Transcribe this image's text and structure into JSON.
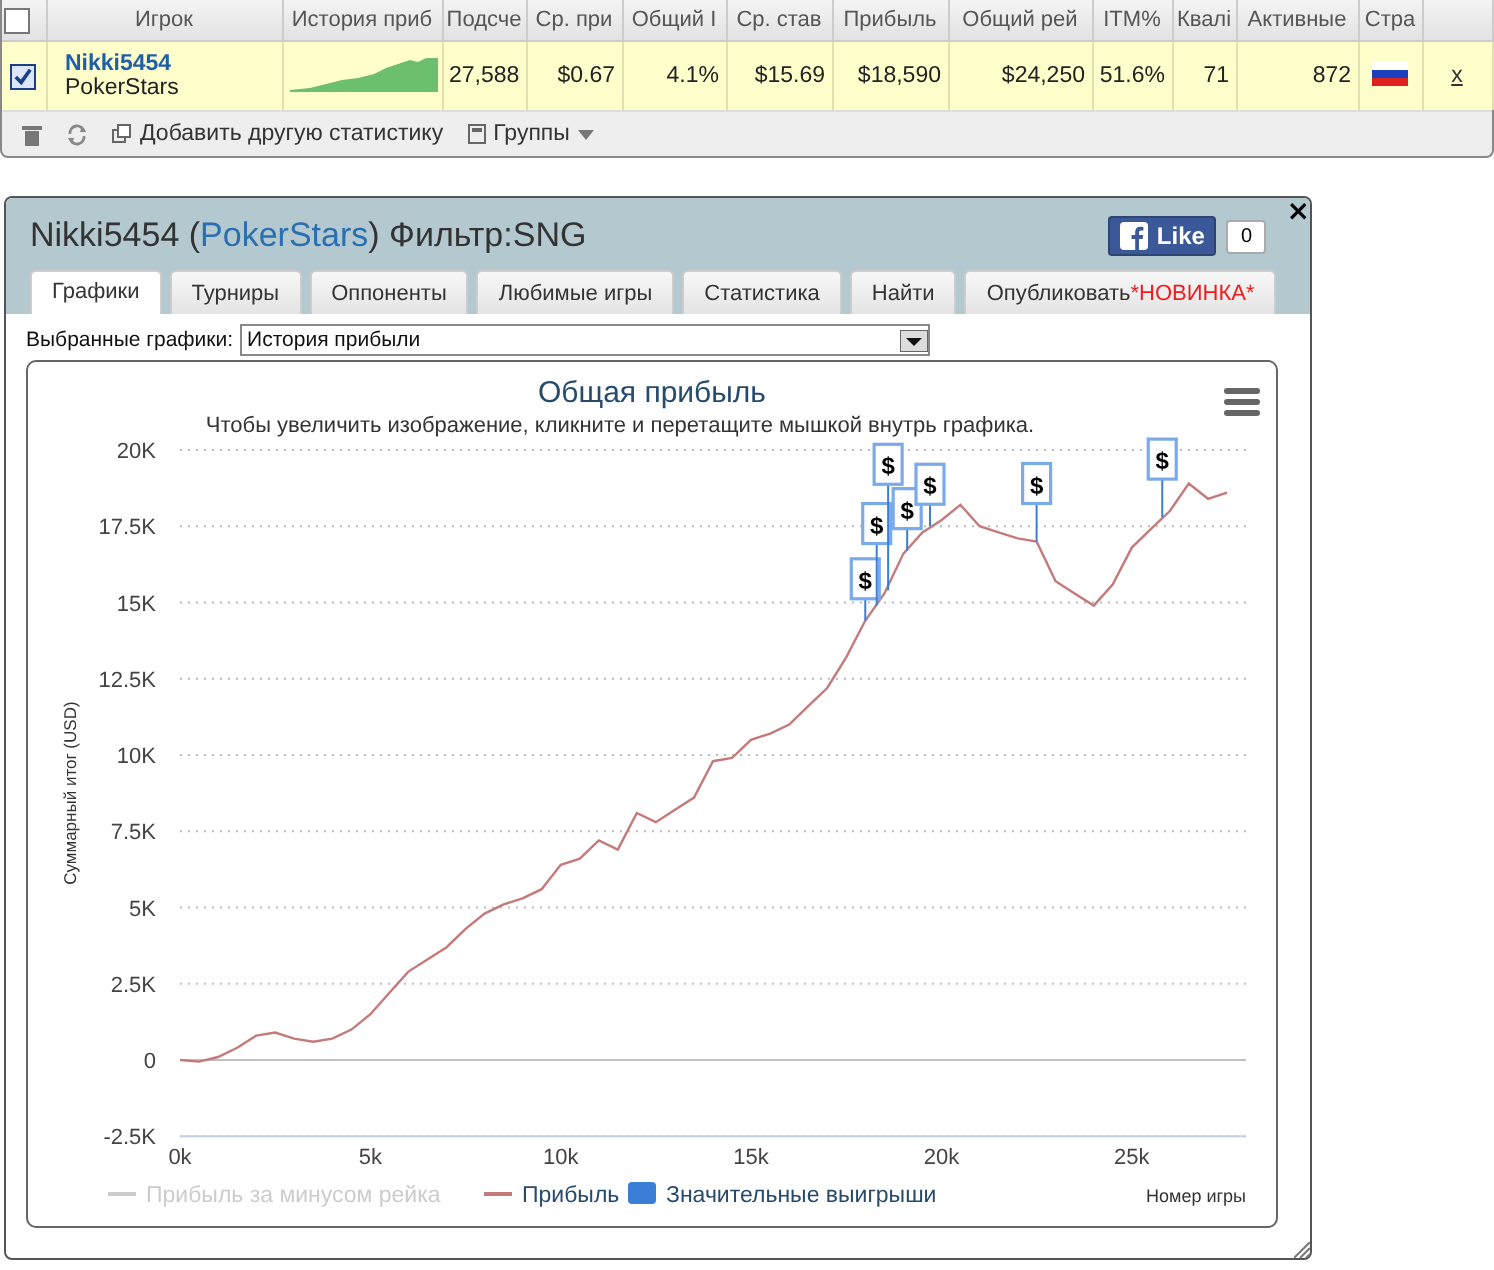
{
  "stats_table": {
    "header_checked": false,
    "columns": [
      "",
      "Игрок",
      "История приб",
      "Подсче",
      "Ср. при",
      "Общий I",
      "Ср. став",
      "Прибыль",
      "Общий рей",
      "ITM%",
      "Квалі",
      "Активные",
      "Стра",
      ""
    ],
    "rows": [
      {
        "cells": [
          {
            "kind": "checkbox",
            "checked": true
          },
          {
            "kind": "player",
            "player": "Nikki5454",
            "site": "PokerStars"
          },
          {
            "kind": "sparkline"
          },
          {
            "kind": "text",
            "text": "27,588"
          },
          {
            "kind": "text",
            "text": "$0.67"
          },
          {
            "kind": "text",
            "text": "4.1%"
          },
          {
            "kind": "text",
            "text": "$15.69"
          },
          {
            "kind": "text",
            "text": "$18,590"
          },
          {
            "kind": "text",
            "text": "$24,250"
          },
          {
            "kind": "text",
            "text": "51.6%"
          },
          {
            "kind": "text",
            "text": "71"
          },
          {
            "kind": "text",
            "text": "872"
          },
          {
            "kind": "flag"
          },
          {
            "kind": "link",
            "text": "x"
          }
        ]
      }
    ],
    "toolbar": {
      "add_stat": "Добавить другую статистику",
      "groups": "Группы"
    }
  },
  "dialog": {
    "title_player": "Nikki5454 (",
    "title_site": "PokerStars",
    "title_filter": ") Фильтр:SNG",
    "like": "Like",
    "like_count": "0",
    "close": "×",
    "tabs": [
      {
        "label": "Графики",
        "selected": true
      },
      {
        "label": "Турниры",
        "selected": false
      },
      {
        "label": "Оппоненты",
        "selected": false
      },
      {
        "label": "Любимые игры",
        "selected": false
      },
      {
        "label": "Статистика",
        "selected": false
      },
      {
        "label": "Найти",
        "selected": false
      },
      {
        "label": "Опубликовать",
        "badge": "*НОВИНКА*",
        "selected": false
      }
    ],
    "graph_select": {
      "label": "Выбранные графики:",
      "value": "История прибыли"
    },
    "chart": {
      "hint": "Чтобы увеличить изображение, кликните и перетащите мышкой внутрь графика.",
      "legend": [
        {
          "label": "Прибыль за минусом рейка",
          "kind": "line",
          "hidden": true
        },
        {
          "kind": "series",
          "hidden": false
        },
        {
          "label": "Значительные выигрыши",
          "kind": "box",
          "hidden": false,
          "color": "#3a7fd5"
        }
      ],
      "chart_data": {
        "type": "line",
        "grid": true,
        "title": "Общая прибыль",
        "xlabel": "Номер игры",
        "ylabel": "Суммарный итог (USD)",
        "x": [
          0,
          500,
          1000,
          1500,
          2000,
          2500,
          3000,
          3500,
          4000,
          4500,
          5000,
          5500,
          6000,
          6500,
          7000,
          7500,
          8000,
          8500,
          9000,
          9500,
          10000,
          10500,
          11000,
          11500,
          12000,
          12500,
          13000,
          13500,
          14000,
          14500,
          15000,
          15500,
          16000,
          16500,
          17000,
          17500,
          18000,
          18500,
          19000,
          19500,
          20000,
          20500,
          21000,
          21500,
          22000,
          22500,
          23000,
          23500,
          24000,
          24500,
          25000,
          25500,
          26000,
          26500,
          27000,
          27500
        ],
        "series": [
          {
            "name": "Прибыль",
            "color": "#c47a7a",
            "values": [
              0,
              -50,
              100,
              400,
              800,
              900,
              700,
              600,
              700,
              1000,
              1500,
              2200,
              2900,
              3300,
              3700,
              4300,
              4800,
              5100,
              5300,
              5600,
              6400,
              6600,
              7200,
              6900,
              8100,
              7800,
              8200,
              8600,
              9800,
              9900,
              10500,
              10700,
              11000,
              11600,
              12200,
              13200,
              14400,
              15300,
              16600,
              17300,
              17700,
              18200,
              17500,
              17300,
              17100,
              17000,
              15700,
              15300,
              14900,
              15600,
              16800,
              17400,
              18000,
              18900,
              18400,
              18600
            ]
          }
        ],
        "xlim": [
          0,
          28000
        ],
        "ylim": [
          -2500,
          20000
        ],
        "xticks": [
          {
            "value": 0,
            "label": "0k"
          },
          {
            "value": 5000,
            "label": "5k"
          },
          {
            "value": 10000,
            "label": "10k"
          },
          {
            "value": 15000,
            "label": "15k"
          },
          {
            "value": 20000,
            "label": "20k"
          },
          {
            "value": 25000,
            "label": "25k"
          }
        ],
        "yticks": [
          {
            "value": -2500,
            "label": "-2.5K"
          },
          {
            "value": 0,
            "label": "0"
          },
          {
            "value": 2500,
            "label": "2.5K"
          },
          {
            "value": 5000,
            "label": "5K"
          },
          {
            "value": 7500,
            "label": "7.5K"
          },
          {
            "value": 10000,
            "label": "10K"
          },
          {
            "value": 12500,
            "label": "12.5K"
          },
          {
            "value": 15000,
            "label": "15K"
          },
          {
            "value": 17500,
            "label": "17.5K"
          },
          {
            "value": 20000,
            "label": "20K"
          }
        ],
        "annotations": [
          {
            "x": 18000,
            "y": 14400,
            "text": "$"
          },
          {
            "x": 18300,
            "y": 14900,
            "text": "$"
          },
          {
            "x": 18600,
            "y": 15400,
            "text": "$"
          },
          {
            "x": 19100,
            "y": 16700,
            "text": "$"
          },
          {
            "x": 19700,
            "y": 17500,
            "text": "$"
          },
          {
            "x": 22500,
            "y": 17000,
            "text": "$"
          },
          {
            "x": 25800,
            "y": 17800,
            "text": "$"
          }
        ]
      }
    }
  }
}
